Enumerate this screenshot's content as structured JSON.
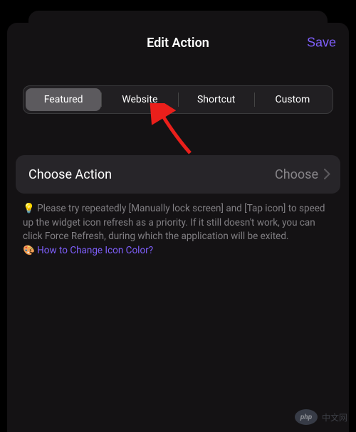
{
  "header": {
    "title": "Edit Action",
    "save_label": "Save"
  },
  "segmented": {
    "items": [
      {
        "label": "Featured",
        "active": true
      },
      {
        "label": "Website",
        "active": false
      },
      {
        "label": "Shortcut",
        "active": false
      },
      {
        "label": "Custom",
        "active": false
      }
    ]
  },
  "action_row": {
    "label": "Choose Action",
    "value": "Choose"
  },
  "hint": {
    "bulb_emoji": "💡",
    "text": " Please try repeatedly [Manually lock screen] and [Tap icon] to speed up the widget icon refresh as a priority. If it still doesn't work, you can click Force Refresh, during which the application will be exited.",
    "palette_emoji": "🎨",
    "link_text": "How to Change Icon Color?"
  },
  "watermark": {
    "badge": "php",
    "text": "中文网"
  },
  "colors": {
    "accent": "#7f5ffc",
    "arrow": "#ea1f1b"
  }
}
